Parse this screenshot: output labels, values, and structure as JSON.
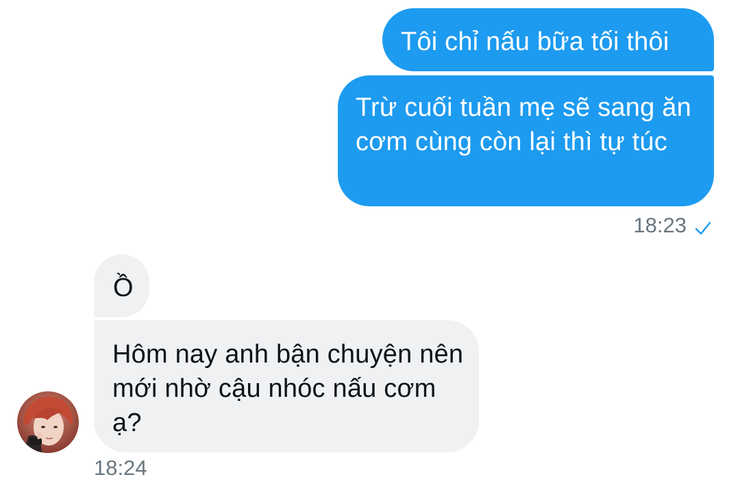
{
  "messages": {
    "outgoing": [
      {
        "text": "Tôi chỉ nấu bữa tối thôi"
      },
      {
        "text": "Trừ cuối tuần mẹ sẽ sang ăn cơm cùng còn lại thì tự túc"
      }
    ],
    "outgoing_time": "18:23",
    "outgoing_status_icon": "check-icon",
    "incoming": [
      {
        "text": "Ồ"
      },
      {
        "text": "Hôm nay anh bận chuyện nên mới nhờ cậu nhóc nấu cơm ạ?"
      }
    ],
    "incoming_time": "18:24"
  },
  "colors": {
    "outgoing_bubble": "#1d9bf0",
    "incoming_bubble": "#eff1f3",
    "timestamp": "#69767f",
    "check": "#1d9bf0"
  }
}
